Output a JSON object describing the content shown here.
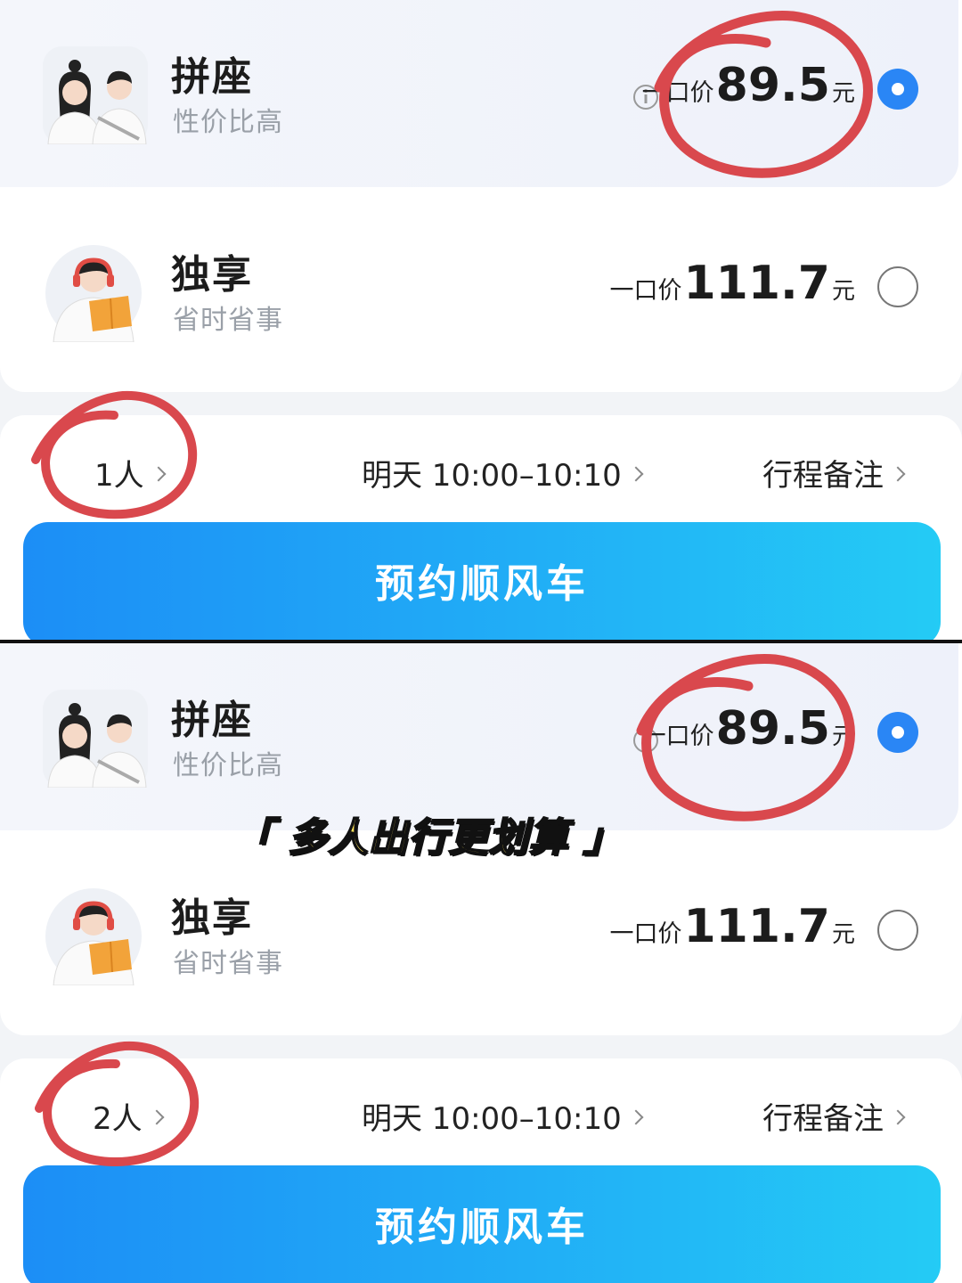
{
  "panels": [
    {
      "options": [
        {
          "title": "拼座",
          "subtitle": "性价比高",
          "price_label": "一口价",
          "price_value": "89.5",
          "price_unit": "元",
          "selected": true,
          "icon": "two-passengers-avatar"
        },
        {
          "title": "独享",
          "subtitle": "省时省事",
          "price_label": "一口价",
          "price_value": "111.7",
          "price_unit": "元",
          "selected": false,
          "icon": "solo-passenger-reading-avatar"
        }
      ],
      "bar": {
        "passengers": "1人",
        "time": "明天 10:00–10:10",
        "notes": "行程备注"
      },
      "cta": "预约顺风车"
    },
    {
      "options": [
        {
          "title": "拼座",
          "subtitle": "性价比高",
          "price_label": "一口价",
          "price_value": "89.5",
          "price_unit": "元",
          "selected": true,
          "icon": "two-passengers-avatar"
        },
        {
          "title": "独享",
          "subtitle": "省时省事",
          "price_label": "一口价",
          "price_value": "111.7",
          "price_unit": "元",
          "selected": false,
          "icon": "solo-passenger-reading-avatar"
        }
      ],
      "bar": {
        "passengers": "2人",
        "time": "明天 10:00–10:10",
        "notes": "行程备注"
      },
      "cta": "预约顺风车"
    }
  ],
  "caption": "「 多人出行更划算 」",
  "colors": {
    "accent": "#2a86f5",
    "annotation": "#d9484d",
    "caption": "#ffe45c"
  }
}
